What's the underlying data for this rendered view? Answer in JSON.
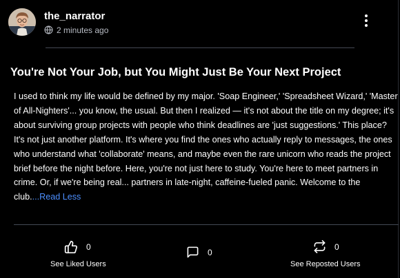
{
  "post": {
    "username": "the_narrator",
    "timestamp": "2 minutes ago",
    "title": "You're Not Your Job, but You Might Just Be Your Next Project",
    "body": "I used to think my life would be defined by my major. 'Soap Engineer,' 'Spreadsheet Wizard,' 'Master of All-Nighters'... you know, the usual. But then I realized — it's not about the title on my degree; it's about surviving group projects with people who think deadlines are 'just suggestions.' This place? It's not just another platform. It's where you find the ones who actually reply to messages, the ones who understand what 'collaborate' means, and maybe even the rare unicorn who reads the project brief before the night before. Here, you're not just here to study. You're here to meet partners in crime. Or, if we're being real... partners in late-night, caffeine-fueled panic. Welcome to the club.",
    "read_less": "...Read Less"
  },
  "actions": {
    "like_count": "0",
    "comment_count": "0",
    "repost_count": "0",
    "liked_users_label": "See Liked Users",
    "reposted_users_label": "See Reposted Users"
  },
  "icons": {
    "visibility": "globe-icon",
    "menu": "more-vertical-icon",
    "like": "thumbs-up-icon",
    "comment": "comment-icon",
    "repost": "repost-icon"
  },
  "colors": {
    "background": "#000000",
    "link": "#4d8fff",
    "meta_text": "#b8bcc4",
    "divider": "#454a55"
  }
}
